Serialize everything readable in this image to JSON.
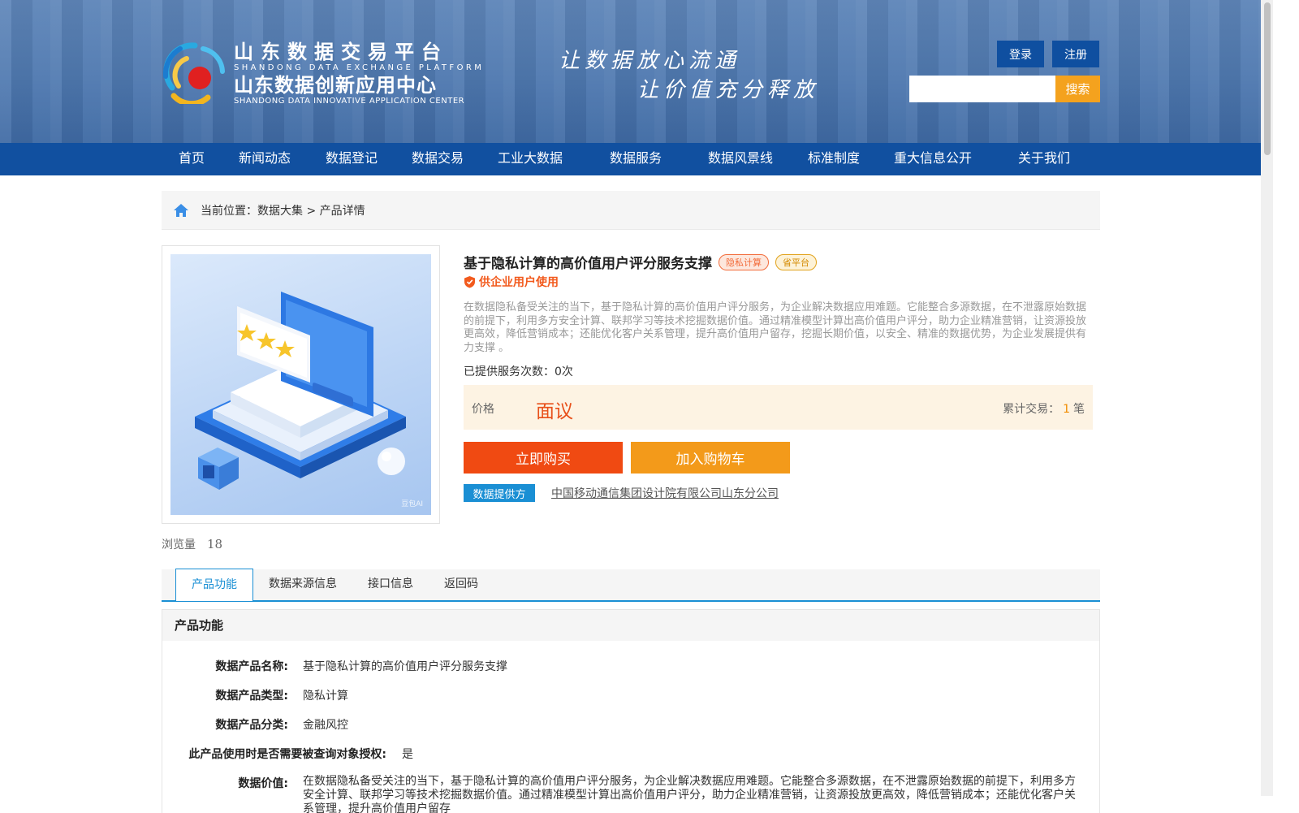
{
  "header": {
    "brand_cn1": "山东数据交易平台",
    "brand_en1": "SHANDONG DATA EXCHANGE PLATFORM",
    "brand_cn2": "山东数据创新应用中心",
    "brand_en2": "SHANDONG DATA INNOVATIVE APPLICATION CENTER",
    "slogan1": "让数据放心流通",
    "slogan2": "让价值充分释放",
    "login": "登录",
    "register": "注册",
    "search_placeholder": "",
    "search_button": "搜索"
  },
  "nav": [
    "首页",
    "新闻动态",
    "数据登记",
    "数据交易",
    "工业大数据",
    "数据服务",
    "数据风景线",
    "标准制度",
    "重大信息公开",
    "关于我们"
  ],
  "breadcrumb": "当前位置：数据大集 > 产品详情",
  "product": {
    "image_watermark": "豆包AI",
    "title": "基于隐私计算的高价值用户评分服务支撑",
    "tag1": "隐私计算",
    "tag2": "省平台",
    "enterprise_label": "供企业用户使用",
    "description": "在数据隐私备受关注的当下，基于隐私计算的高价值用户评分服务，为企业解决数据应用难题。它能整合多源数据，在不泄露原始数据的前提下，利用多方安全计算、联邦学习等技术挖掘数据价值。通过精准模型计算出高价值用户评分，助力企业精准营销，让资源投放更高效，降低营销成本；还能优化客户关系管理，提升高价值用户留存，挖掘长期价值，以安全、精准的数据优势，为企业发展提供有力支撑 。",
    "service_count": "已提供服务次数：0次",
    "price_label": "价格",
    "price_value": "面议",
    "trade_label": "累计交易：",
    "trade_count": "1",
    "trade_unit": "笔",
    "buy_button": "立即购买",
    "cart_button": "加入购物车",
    "provider_tag": "数据提供方",
    "provider_name": "中国移动通信集团设计院有限公司山东分公司",
    "views_label": "浏览量",
    "views_count": "18"
  },
  "tabs": [
    "产品功能",
    "数据来源信息",
    "接口信息",
    "返回码"
  ],
  "section": {
    "title": "产品功能",
    "rows": [
      {
        "label": "数据产品名称:",
        "value": "基于隐私计算的高价值用户评分服务支撑"
      },
      {
        "label": "数据产品类型:",
        "value": "隐私计算"
      },
      {
        "label": "数据产品分类:",
        "value": "金融风控"
      },
      {
        "label": "此产品使用时是否需要被查询对象授权:",
        "value": "是"
      },
      {
        "label": "数据价值:",
        "value": "在数据隐私备受关注的当下，基于隐私计算的高价值用户评分服务，为企业解决数据应用难题。它能整合多源数据，在不泄露原始数据的前提下，利用多方安全计算、联邦学习等技术挖掘数据价值。通过精准模型计算出高价值用户评分，助力企业精准营销，让资源投放更高效，降低营销成本；还能优化客户关系管理，提升高价值用户留存"
      }
    ]
  },
  "colors": {
    "nav_blue": "#1150a0",
    "accent_blue": "#1a8fd4",
    "buy_orange": "#f04a12",
    "cart_orange": "#f39a1a",
    "price_red": "#e8501a"
  }
}
